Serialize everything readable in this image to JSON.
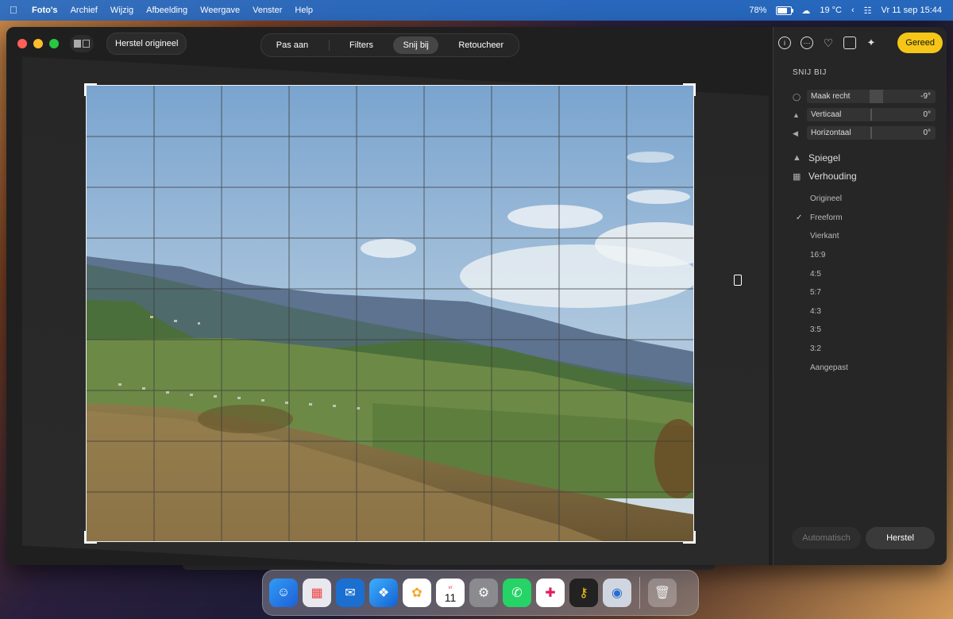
{
  "menubar": {
    "app": "Foto's",
    "items": [
      "Archief",
      "Wijzig",
      "Afbeelding",
      "Weergave",
      "Venster",
      "Help"
    ],
    "battery": "78%",
    "weather": "19 °C",
    "datetime": "Vr 11 sep  15:44"
  },
  "titlebar": {
    "revert_label": "Herstel origineel",
    "tabs": [
      {
        "label": "Pas aan"
      },
      {
        "label": "Filters"
      },
      {
        "label": "Snij bij"
      },
      {
        "label": "Retoucheer"
      }
    ],
    "active_tab": "Snij bij"
  },
  "sidebar": {
    "done_label": "Gereed",
    "section_title": "SNIJ BIJ",
    "sliders": [
      {
        "label": "Maak recht",
        "value": "-9°"
      },
      {
        "label": "Verticaal",
        "value": "0°"
      },
      {
        "label": "Horizontaal",
        "value": "0°"
      }
    ],
    "mirror_label": "Spiegel",
    "aspect_label": "Verhouding",
    "ratios": [
      "Origineel",
      "Freeform",
      "Vierkant",
      "16:9",
      "4:5",
      "5:7",
      "4:3",
      "3:5",
      "3:2",
      "Aangepast"
    ],
    "selected_ratio": "Freeform",
    "auto_label": "Automatisch",
    "reset_label": "Herstel"
  },
  "dock": {
    "calendar_day": "11",
    "calendar_month": "vr"
  },
  "colors": {
    "accent": "#f5c518",
    "menubar": "#286ec8"
  }
}
